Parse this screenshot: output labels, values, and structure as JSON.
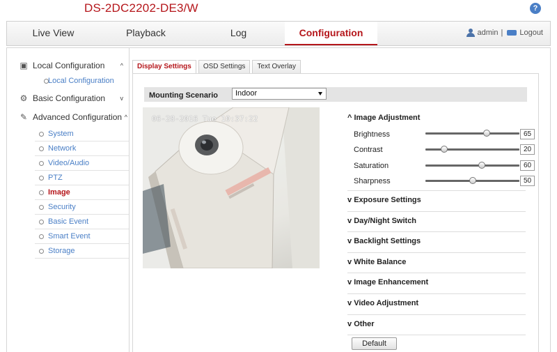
{
  "header": {
    "model": "DS-2DC2202-DE3/W",
    "help_label": "?"
  },
  "nav": {
    "tabs": [
      {
        "label": "Live View"
      },
      {
        "label": "Playback"
      },
      {
        "label": "Log"
      },
      {
        "label": "Configuration"
      }
    ],
    "active_tab": "Configuration",
    "user": "admin",
    "separator": "|",
    "logout": "Logout"
  },
  "sidebar": {
    "local": {
      "label": "Local Configuration",
      "chevron": "^",
      "items": [
        "Local Configuration"
      ]
    },
    "basic": {
      "label": "Basic Configuration",
      "chevron": "v"
    },
    "advanced": {
      "label": "Advanced Configuration",
      "chevron": "^",
      "items": [
        "System",
        "Network",
        "Video/Audio",
        "PTZ",
        "Image",
        "Security",
        "Basic Event",
        "Smart Event",
        "Storage"
      ],
      "active_item": "Image"
    }
  },
  "tabs": [
    "Display Settings",
    "OSD Settings",
    "Text Overlay"
  ],
  "active_tab": "Display Settings",
  "mounting": {
    "label": "Mounting Scenario",
    "value": "Indoor"
  },
  "video": {
    "osd": "06-28-2016 Tue 10:37:22"
  },
  "image_adjustment": {
    "title": "Image Adjustment",
    "sliders": [
      {
        "label": "Brightness",
        "value": "65"
      },
      {
        "label": "Contrast",
        "value": "20"
      },
      {
        "label": "Saturation",
        "value": "60"
      },
      {
        "label": "Sharpness",
        "value": "50"
      }
    ]
  },
  "sections": [
    "Exposure Settings",
    "Day/Night Switch",
    "Backlight Settings",
    "White Balance",
    "Image Enhancement",
    "Video Adjustment",
    "Other"
  ],
  "expand_glyphs": {
    "open": "^",
    "closed": "v"
  },
  "default_button": "Default",
  "colors": {
    "accent": "#b5161b",
    "link": "#4a7fc6"
  }
}
